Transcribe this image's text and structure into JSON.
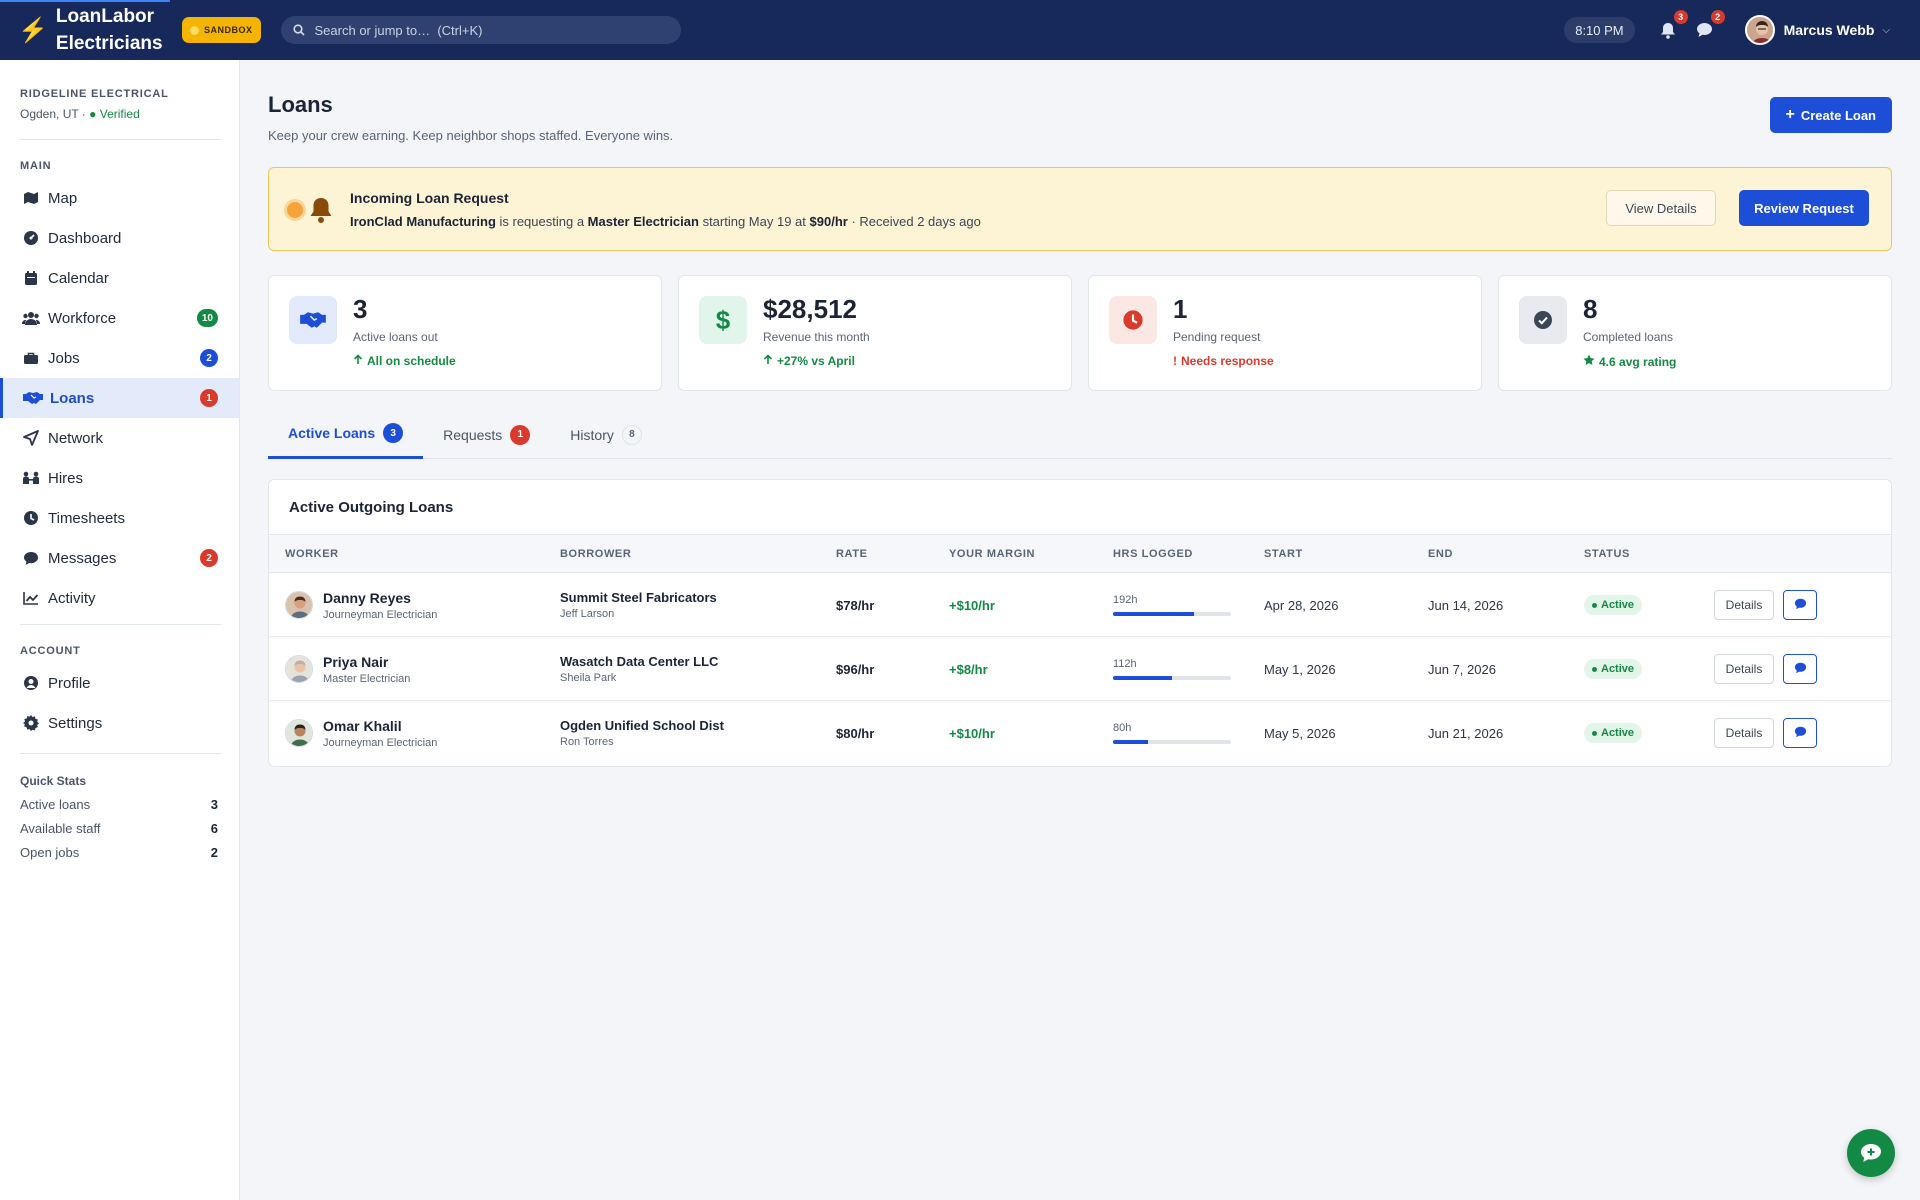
{
  "brand": {
    "name_line1": "LoanLabor",
    "name_line2": "Electricians",
    "sandbox_label": "SANDBOX"
  },
  "search": {
    "placeholder": "Search or jump to…  (Ctrl+K)"
  },
  "topbar": {
    "time": "8:10 PM",
    "notifications_count": "3",
    "messages_count": "2",
    "user_name": "Marcus Webb"
  },
  "org": {
    "name": "RIDGELINE ELECTRICAL",
    "location": "Ogden, UT · ",
    "verified": "● Verified"
  },
  "sidebar": {
    "main_label": "MAIN",
    "items": [
      {
        "label": "Map",
        "icon": "map-icon"
      },
      {
        "label": "Dashboard",
        "icon": "dashboard-icon"
      },
      {
        "label": "Calendar",
        "icon": "calendar-icon"
      },
      {
        "label": "Workforce",
        "icon": "users-icon",
        "badge": "10",
        "badge_color": "#138a43"
      },
      {
        "label": "Jobs",
        "icon": "briefcase-icon",
        "badge": "2",
        "badge_color": "#1d4ed8"
      },
      {
        "label": "Loans",
        "icon": "handshake-icon",
        "badge": "1",
        "badge_color": "#d93a2b",
        "active": true
      },
      {
        "label": "Network",
        "icon": "network-icon"
      },
      {
        "label": "Hires",
        "icon": "hires-icon"
      },
      {
        "label": "Timesheets",
        "icon": "clock-icon"
      },
      {
        "label": "Messages",
        "icon": "chat-icon",
        "badge": "2",
        "badge_color": "#d93a2b"
      },
      {
        "label": "Activity",
        "icon": "activity-icon"
      }
    ],
    "account_label": "ACCOUNT",
    "account_items": [
      {
        "label": "Profile",
        "icon": "profile-icon"
      },
      {
        "label": "Settings",
        "icon": "gear-icon"
      }
    ],
    "quick_stats": {
      "title": "Quick Stats",
      "rows": [
        {
          "label": "Active loans",
          "value": "3"
        },
        {
          "label": "Available staff",
          "value": "6"
        },
        {
          "label": "Open jobs",
          "value": "2"
        }
      ]
    }
  },
  "page": {
    "title": "Loans",
    "subtitle": "Keep your crew earning. Keep neighbor shops staffed. Everyone wins.",
    "create_button": "Create Loan"
  },
  "alert": {
    "title": "Incoming Loan Request",
    "company": "IronClad Manufacturing",
    "text1": " is requesting a ",
    "role": "Master Electrician",
    "text2": " starting May 19 at ",
    "rate": "$90/hr",
    "text3": " · Received 2 days ago",
    "view_button": "View Details",
    "review_button": "Review Request"
  },
  "stats": [
    {
      "value": "3",
      "label": "Active loans out",
      "foot": "All on schedule",
      "foot_icon": "arrow-up-icon",
      "foot_color": "#138a43",
      "icon": "handshake-icon",
      "icon_bg": "#e2eafb",
      "icon_color": "#1d4ed8"
    },
    {
      "value": "$28,512",
      "label": "Revenue this month",
      "foot": "+27% vs April",
      "foot_icon": "arrow-up-icon",
      "foot_color": "#138a43",
      "icon": "dollar-icon",
      "icon_bg": "#e2f5ea",
      "icon_color": "#138a43"
    },
    {
      "value": "1",
      "label": "Pending request",
      "foot": "Needs response",
      "foot_icon": "exclamation-icon",
      "foot_color": "#d93a2b",
      "icon": "clock-icon",
      "icon_bg": "#fbe7e3",
      "icon_color": "#d93a2b"
    },
    {
      "value": "8",
      "label": "Completed loans",
      "foot": "4.6 avg rating",
      "foot_icon": "star-icon",
      "foot_color": "#138a43",
      "icon": "check-icon",
      "icon_bg": "#e8eaef",
      "icon_color": "#3d4658"
    }
  ],
  "tabs": [
    {
      "label": "Active Loans",
      "count": "3",
      "active": true
    },
    {
      "label": "Requests",
      "count": "1"
    },
    {
      "label": "History",
      "count": "8"
    }
  ],
  "table": {
    "title": "Active Outgoing Loans",
    "columns": [
      "WORKER",
      "BORROWER",
      "RATE",
      "YOUR MARGIN",
      "HRS LOGGED",
      "START",
      "END",
      "STATUS"
    ],
    "rows": [
      {
        "worker": "Danny Reyes",
        "role": "Journeyman Electrician",
        "borrower": "Summit Steel Fabricators",
        "contact": "Jeff Larson",
        "rate": "$78/hr",
        "margin": "+$10/hr",
        "hours": "192h",
        "progress": 0.69,
        "start": "Apr 28, 2026",
        "end": "Jun 14, 2026",
        "status": "Active",
        "details": "Details"
      },
      {
        "worker": "Priya Nair",
        "role": "Master Electrician",
        "borrower": "Wasatch Data Center LLC",
        "contact": "Sheila Park",
        "rate": "$96/hr",
        "margin": "+$8/hr",
        "hours": "112h",
        "progress": 0.5,
        "start": "May 1, 2026",
        "end": "Jun 7, 2026",
        "status": "Active",
        "details": "Details"
      },
      {
        "worker": "Omar Khalil",
        "role": "Journeyman Electrician",
        "borrower": "Ogden Unified School Dist",
        "contact": "Ron Torres",
        "rate": "$80/hr",
        "margin": "+$10/hr",
        "hours": "80h",
        "progress": 0.3,
        "start": "May 5, 2026",
        "end": "Jun 21, 2026",
        "status": "Active",
        "details": "Details"
      }
    ]
  },
  "colors": {
    "primary": "#1d4ed8",
    "topbar": "#16295a",
    "success": "#138a43",
    "danger": "#d93a2b",
    "warning": "#f5b400"
  }
}
